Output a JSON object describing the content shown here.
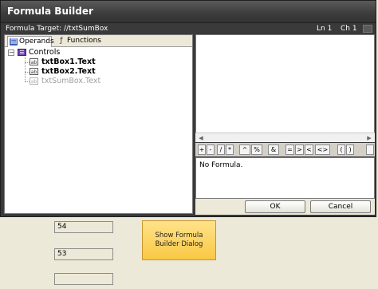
{
  "window": {
    "title": "Formula Builder",
    "formula_target": "Formula Target: //txtSumBox",
    "line": "Ln 1",
    "column": "Ch 1"
  },
  "tabs": [
    {
      "label": "Operands",
      "icon": "operands-icon",
      "selected": true
    },
    {
      "label": "Functions",
      "icon": "functions-icon",
      "selected": false
    }
  ],
  "tree": {
    "root": {
      "label": "Controls",
      "icon": "controls-icon",
      "expanded": true
    },
    "children": [
      {
        "label": "txtBox1.Text",
        "icon": "textbox-icon"
      },
      {
        "label": "txtBox2.Text",
        "icon": "textbox-icon"
      },
      {
        "label": "txtSumBox.Text",
        "icon": "textbox-icon",
        "disabled": true
      }
    ]
  },
  "operators": [
    "+",
    "-",
    "/",
    "*",
    "^",
    "%",
    "&",
    "=",
    ">",
    "<",
    "<>",
    "(",
    ")"
  ],
  "output": {
    "text": "No Formula."
  },
  "buttons": {
    "ok": "OK",
    "cancel": "Cancel"
  },
  "form": {
    "field1": "54",
    "field2": "53",
    "field3": "",
    "show_button": "Show Formula Builder Dialog"
  }
}
